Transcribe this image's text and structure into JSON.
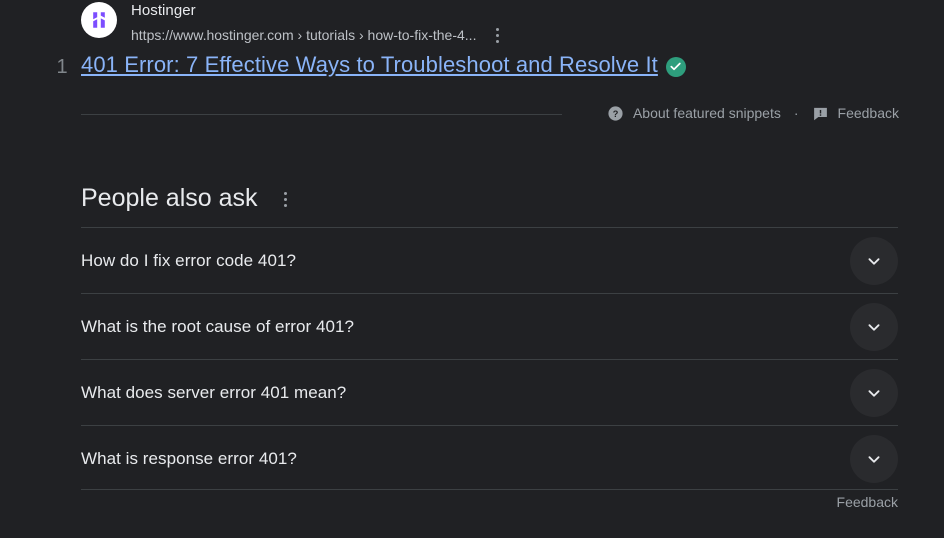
{
  "theme": {
    "background": "#202124",
    "text_primary": "#e8eaed",
    "text_secondary": "#bdc1c6",
    "text_muted": "#9aa0a6",
    "link_blue": "#8ab4f8",
    "divider": "#3c4043",
    "badge_green": "#2e9e7d",
    "favicon_purple": "#7c4dff",
    "toggle_bg": "#2a2b2e"
  },
  "featured_snippet": {
    "source_name": "Hostinger",
    "source_url": "https://www.hostinger.com › tutorials › how-to-fix-the-4...",
    "favicon_icon": "hostinger-logo-icon",
    "more_options_icon": "kebab-menu-icon",
    "result_rank": "1",
    "title": "401 Error: 7 Effective Ways to Troubleshoot and Resolve It",
    "verified_icon": "verified-check-icon",
    "footer": {
      "about_icon": "question-mark-circle-icon",
      "about_label": "About featured snippets",
      "separator": "·",
      "feedback_icon": "feedback-flag-icon",
      "feedback_label": "Feedback"
    }
  },
  "people_also_ask": {
    "heading": "People also ask",
    "menu_icon": "kebab-menu-icon",
    "expand_icon": "chevron-down-icon",
    "questions": [
      {
        "text": "How do I fix error code 401?"
      },
      {
        "text": "What is the root cause of error 401?"
      },
      {
        "text": "What does server error 401 mean?"
      },
      {
        "text": "What is response error 401?"
      }
    ],
    "feedback_label": "Feedback"
  }
}
